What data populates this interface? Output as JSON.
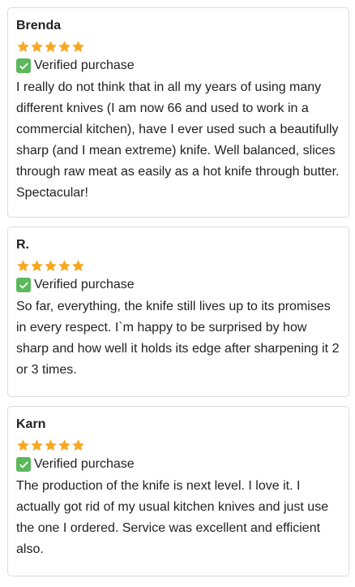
{
  "reviews": [
    {
      "name": "Brenda",
      "rating": 5,
      "verified": "Verified purchase",
      "text": "I really do not think that in all my years of using many different knives (I am now 66 and used to work in a commercial kitchen), have I ever used such a beautifully sharp (and I mean extreme) knife. Well balanced, slices through raw meat as easily as a hot knife through butter. Spectacular!"
    },
    {
      "name": "R.",
      "rating": 5,
      "verified": "Verified purchase",
      "text": "So far, everything, the knife still lives up to its promises in every respect. I`m happy to be surprised by how sharp and how well it holds its edge after sharpening it 2 or 3 times."
    },
    {
      "name": "Karn",
      "rating": 5,
      "verified": "Verified purchase",
      "text": "The production of the knife is next level. I love it. I actually got rid of my usual kitchen knives and just use the one I ordered. Service was excellent and efficient also."
    }
  ],
  "colors": {
    "star": "#f7a823",
    "check": "#5bb85b",
    "border": "#dcdcdc"
  },
  "icons": {
    "star": "star-icon",
    "verified": "check-icon"
  }
}
